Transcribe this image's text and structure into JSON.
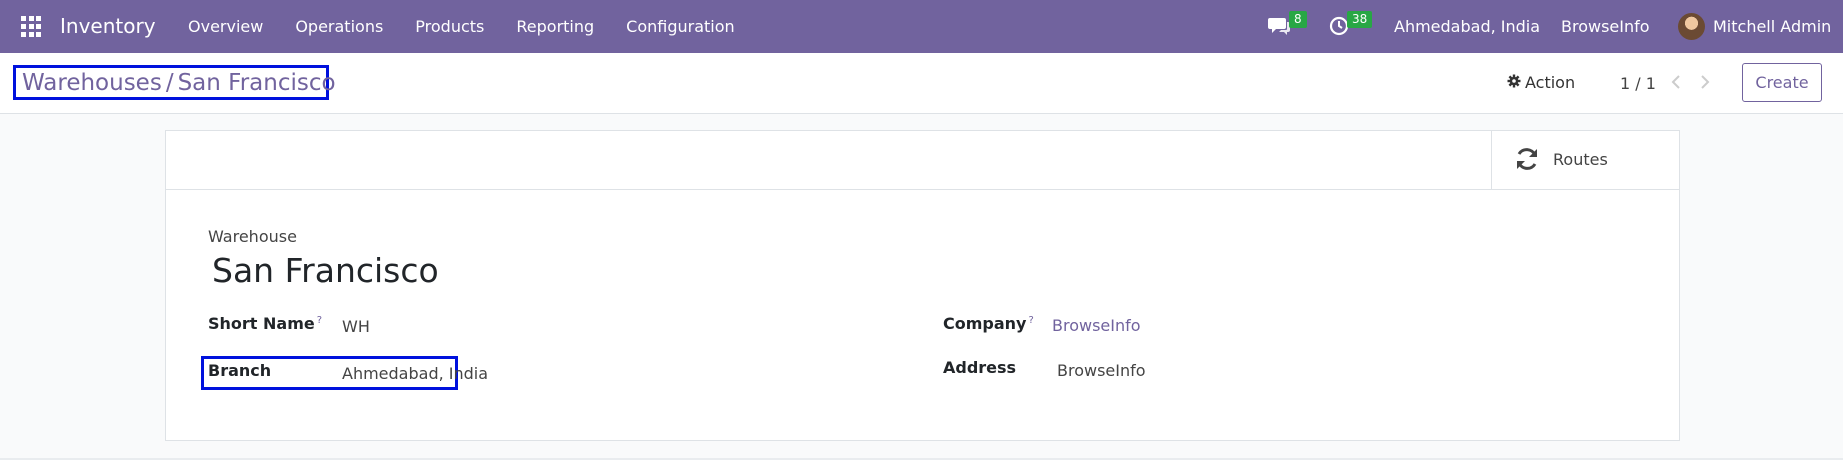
{
  "nav": {
    "brand": "Inventory",
    "menu": [
      "Overview",
      "Operations",
      "Products",
      "Reporting",
      "Configuration"
    ],
    "messages_badge": "8",
    "activities_badge": "38",
    "branch": "Ahmedabad, India",
    "company": "BrowseInfo",
    "user": "Mitchell Admin"
  },
  "control": {
    "breadcrumb_parent": "Warehouses",
    "breadcrumb_sep": "/",
    "breadcrumb_current": "San Francisco",
    "action_label": "Action",
    "pager": "1 / 1",
    "create_label": "Create"
  },
  "form": {
    "routes_label": "Routes",
    "warehouse_label": "Warehouse",
    "warehouse_name": "San Francisco",
    "short_name_label": "Short Name",
    "short_name_help": "?",
    "short_name_value": "WH",
    "branch_label": "Branch",
    "branch_value": "Ahmedabad, India",
    "company_label": "Company",
    "company_help": "?",
    "company_value": "BrowseInfo",
    "address_label": "Address",
    "address_value": "BrowseInfo"
  },
  "colors": {
    "brand": "#71639e",
    "badge": "#28a745",
    "highlight": "#0011dd"
  },
  "icons": [
    "apps-grid-icon",
    "chat-icon",
    "clock-icon",
    "gear-icon",
    "chevron-left-icon",
    "chevron-right-icon",
    "refresh-icon"
  ]
}
